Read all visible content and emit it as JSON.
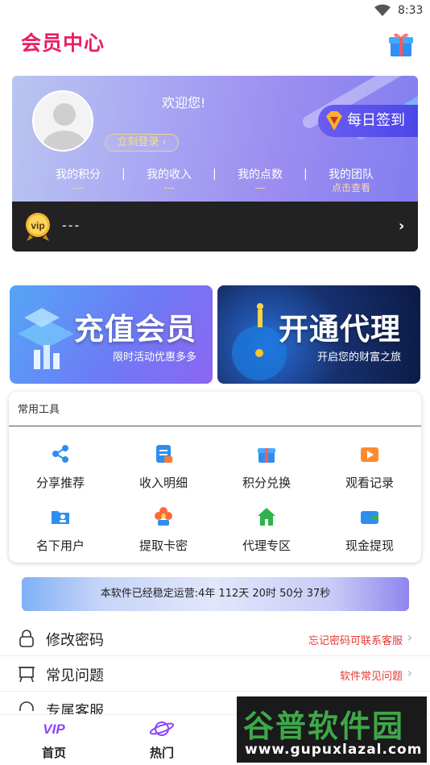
{
  "status_bar": {
    "time": "8:33"
  },
  "header": {
    "title": "会员中心"
  },
  "profile": {
    "welcome": "欢迎您!",
    "login_label": "立刻登录",
    "checkin_label": "每日签到",
    "stats": [
      {
        "label": "我的积分",
        "value": "---"
      },
      {
        "label": "我的收入",
        "value": "---"
      },
      {
        "label": "我的点数",
        "value": "---"
      },
      {
        "label": "我的团队",
        "value": "点击查看"
      }
    ],
    "vip_badge": "vip",
    "vip_text": "---"
  },
  "banners": [
    {
      "title": "充值会员",
      "subtitle": "限时活动优惠多多"
    },
    {
      "title": "开通代理",
      "subtitle": "开启您的财富之旅"
    }
  ],
  "tools": {
    "title": "常用工具",
    "items": [
      {
        "label": "分享推荐",
        "icon": "share-icon"
      },
      {
        "label": "收入明细",
        "icon": "document-icon"
      },
      {
        "label": "积分兑换",
        "icon": "gift-icon"
      },
      {
        "label": "观看记录",
        "icon": "video-icon"
      },
      {
        "label": "名下用户",
        "icon": "folder-user-icon"
      },
      {
        "label": "提取卡密",
        "icon": "flower-icon"
      },
      {
        "label": "代理专区",
        "icon": "home-icon"
      },
      {
        "label": "现金提现",
        "icon": "wallet-icon"
      }
    ]
  },
  "run_status": "本软件已经稳定运营:4年 112天 20时 50分 37秒",
  "menu": [
    {
      "label": "修改密码",
      "right": "忘记密码可联系客服",
      "icon": "lock-icon"
    },
    {
      "label": "常见问题",
      "right": "软件常见问题",
      "icon": "board-icon"
    },
    {
      "label": "专属客服",
      "right": "",
      "icon": "headset-icon"
    }
  ],
  "tabbar": [
    {
      "label": "首页",
      "icon": "vip-icon"
    },
    {
      "label": "热门",
      "icon": "planet-icon"
    }
  ],
  "watermark": {
    "title": "谷普软件园",
    "url": "www.gupuxlazal.com"
  },
  "colors": {
    "accent": "#e91e63",
    "brand_purple": "#6a5cf0",
    "link_red": "#e53935"
  }
}
